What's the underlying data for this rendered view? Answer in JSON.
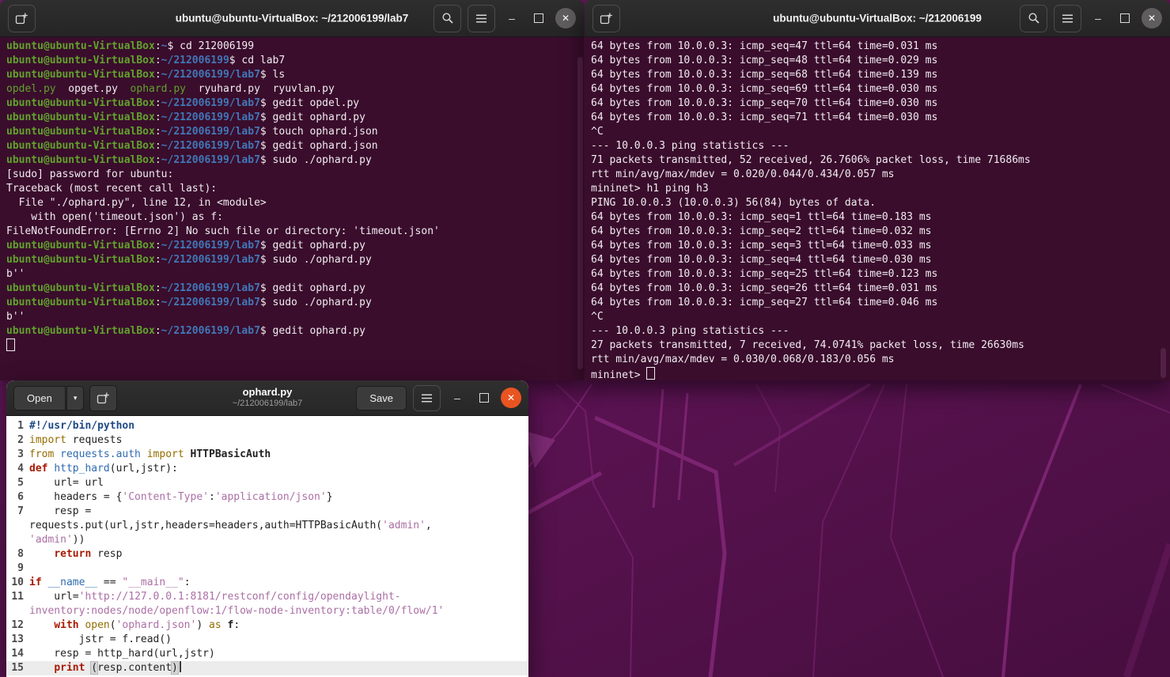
{
  "colors": {
    "accent_orange": "#e95420",
    "terminal_bg": "#3a0d2c",
    "titlebar_bg": "#2c2b2b",
    "prompt_green": "#61a32c",
    "path_blue": "#4177b8",
    "wallpaper_purple": "#5c1353",
    "wallpaper_line": "#822878",
    "string_purple": "#ab6fa5",
    "keyword_red": "#a81a03",
    "import_olive": "#946d00",
    "comment_blue": "#204a87",
    "function_blue": "#2f6bb0"
  },
  "window_glyphs": {
    "minimize": "–",
    "close": "✕",
    "dropdown": "▾"
  },
  "icon_names": [
    "new-tab-icon",
    "search-icon",
    "hamburger-menu-icon",
    "minimize-icon",
    "maximize-icon",
    "close-icon",
    "new-document-icon",
    "dropdown-caret-icon",
    "terminal-cursor"
  ],
  "terminal_left": {
    "title": "ubuntu@ubuntu-VirtualBox: ~/212006199/lab7",
    "lines": [
      [
        [
          "u",
          "ubuntu@ubuntu-VirtualBox"
        ],
        [
          "w",
          ":"
        ],
        [
          "p",
          "~"
        ],
        [
          "w",
          "$ cd 212006199"
        ]
      ],
      [
        [
          "u",
          "ubuntu@ubuntu-VirtualBox"
        ],
        [
          "w",
          ":"
        ],
        [
          "p",
          "~/212006199"
        ],
        [
          "w",
          "$ cd lab7"
        ]
      ],
      [
        [
          "u",
          "ubuntu@ubuntu-VirtualBox"
        ],
        [
          "w",
          ":"
        ],
        [
          "p",
          "~/212006199/lab7"
        ],
        [
          "w",
          "$ ls"
        ]
      ],
      [
        [
          "g",
          "opdel.py"
        ],
        [
          "w",
          "  opget.py  "
        ],
        [
          "g",
          "ophard.py"
        ],
        [
          "w",
          "  ryuhard.py  ryuvlan.py"
        ]
      ],
      [
        [
          "u",
          "ubuntu@ubuntu-VirtualBox"
        ],
        [
          "w",
          ":"
        ],
        [
          "p",
          "~/212006199/lab7"
        ],
        [
          "w",
          "$ gedit opdel.py"
        ]
      ],
      [
        [
          "u",
          "ubuntu@ubuntu-VirtualBox"
        ],
        [
          "w",
          ":"
        ],
        [
          "p",
          "~/212006199/lab7"
        ],
        [
          "w",
          "$ gedit ophard.py"
        ]
      ],
      [
        [
          "u",
          "ubuntu@ubuntu-VirtualBox"
        ],
        [
          "w",
          ":"
        ],
        [
          "p",
          "~/212006199/lab7"
        ],
        [
          "w",
          "$ touch ophard.json"
        ]
      ],
      [
        [
          "u",
          "ubuntu@ubuntu-VirtualBox"
        ],
        [
          "w",
          ":"
        ],
        [
          "p",
          "~/212006199/lab7"
        ],
        [
          "w",
          "$ gedit ophard.json"
        ]
      ],
      [
        [
          "u",
          "ubuntu@ubuntu-VirtualBox"
        ],
        [
          "w",
          ":"
        ],
        [
          "p",
          "~/212006199/lab7"
        ],
        [
          "w",
          "$ sudo ./ophard.py"
        ]
      ],
      [
        [
          "w",
          "[sudo] password for ubuntu:"
        ]
      ],
      [
        [
          "w",
          "Traceback (most recent call last):"
        ]
      ],
      [
        [
          "w",
          "  File \"./ophard.py\", line 12, in <module>"
        ]
      ],
      [
        [
          "w",
          "    with open('timeout.json') as f:"
        ]
      ],
      [
        [
          "w",
          "FileNotFoundError: [Errno 2] No such file or directory: 'timeout.json'"
        ]
      ],
      [
        [
          "u",
          "ubuntu@ubuntu-VirtualBox"
        ],
        [
          "w",
          ":"
        ],
        [
          "p",
          "~/212006199/lab7"
        ],
        [
          "w",
          "$ gedit ophard.py"
        ]
      ],
      [
        [
          "u",
          "ubuntu@ubuntu-VirtualBox"
        ],
        [
          "w",
          ":"
        ],
        [
          "p",
          "~/212006199/lab7"
        ],
        [
          "w",
          "$ sudo ./ophard.py"
        ]
      ],
      [
        [
          "w",
          "b''"
        ]
      ],
      [
        [
          "u",
          "ubuntu@ubuntu-VirtualBox"
        ],
        [
          "w",
          ":"
        ],
        [
          "p",
          "~/212006199/lab7"
        ],
        [
          "w",
          "$ gedit ophard.py"
        ]
      ],
      [
        [
          "u",
          "ubuntu@ubuntu-VirtualBox"
        ],
        [
          "w",
          ":"
        ],
        [
          "p",
          "~/212006199/lab7"
        ],
        [
          "w",
          "$ sudo ./ophard.py"
        ]
      ],
      [
        [
          "w",
          "b''"
        ]
      ],
      [
        [
          "u",
          "ubuntu@ubuntu-VirtualBox"
        ],
        [
          "w",
          ":"
        ],
        [
          "p",
          "~/212006199/lab7"
        ],
        [
          "w",
          "$ gedit ophard.py"
        ]
      ],
      [
        [
          "cursor",
          ""
        ]
      ]
    ]
  },
  "terminal_right": {
    "title": "ubuntu@ubuntu-VirtualBox: ~/212006199",
    "lines": [
      [
        [
          "w",
          "64 bytes from 10.0.0.3: icmp_seq=47 ttl=64 time=0.031 ms"
        ]
      ],
      [
        [
          "w",
          "64 bytes from 10.0.0.3: icmp_seq=48 ttl=64 time=0.029 ms"
        ]
      ],
      [
        [
          "w",
          "64 bytes from 10.0.0.3: icmp_seq=68 ttl=64 time=0.139 ms"
        ]
      ],
      [
        [
          "w",
          "64 bytes from 10.0.0.3: icmp_seq=69 ttl=64 time=0.030 ms"
        ]
      ],
      [
        [
          "w",
          "64 bytes from 10.0.0.3: icmp_seq=70 ttl=64 time=0.030 ms"
        ]
      ],
      [
        [
          "w",
          "64 bytes from 10.0.0.3: icmp_seq=71 ttl=64 time=0.030 ms"
        ]
      ],
      [
        [
          "w",
          "^C"
        ]
      ],
      [
        [
          "w",
          "--- 10.0.0.3 ping statistics ---"
        ]
      ],
      [
        [
          "w",
          "71 packets transmitted, 52 received, 26.7606% packet loss, time 71686ms"
        ]
      ],
      [
        [
          "w",
          "rtt min/avg/max/mdev = 0.020/0.044/0.434/0.057 ms"
        ]
      ],
      [
        [
          "w",
          "mininet> h1 ping h3"
        ]
      ],
      [
        [
          "w",
          "PING 10.0.0.3 (10.0.0.3) 56(84) bytes of data."
        ]
      ],
      [
        [
          "w",
          "64 bytes from 10.0.0.3: icmp_seq=1 ttl=64 time=0.183 ms"
        ]
      ],
      [
        [
          "w",
          "64 bytes from 10.0.0.3: icmp_seq=2 ttl=64 time=0.032 ms"
        ]
      ],
      [
        [
          "w",
          "64 bytes from 10.0.0.3: icmp_seq=3 ttl=64 time=0.033 ms"
        ]
      ],
      [
        [
          "w",
          "64 bytes from 10.0.0.3: icmp_seq=4 ttl=64 time=0.030 ms"
        ]
      ],
      [
        [
          "w",
          "64 bytes from 10.0.0.3: icmp_seq=25 ttl=64 time=0.123 ms"
        ]
      ],
      [
        [
          "w",
          "64 bytes from 10.0.0.3: icmp_seq=26 ttl=64 time=0.031 ms"
        ]
      ],
      [
        [
          "w",
          "64 bytes from 10.0.0.3: icmp_seq=27 ttl=64 time=0.046 ms"
        ]
      ],
      [
        [
          "w",
          "^C"
        ]
      ],
      [
        [
          "w",
          "--- 10.0.0.3 ping statistics ---"
        ]
      ],
      [
        [
          "w",
          "27 packets transmitted, 7 received, 74.0741% packet loss, time 26630ms"
        ]
      ],
      [
        [
          "w",
          "rtt min/avg/max/mdev = 0.030/0.068/0.183/0.056 ms"
        ]
      ],
      [
        [
          "w",
          "mininet> "
        ],
        [
          "cursor",
          ""
        ]
      ]
    ]
  },
  "gedit": {
    "open_label": "Open",
    "save_label": "Save",
    "title": "ophard.py",
    "subtitle": "~/212006199/lab7",
    "rows": [
      {
        "n": "1",
        "seg": [
          [
            "kc",
            "#!/usr/bin/python"
          ]
        ]
      },
      {
        "n": "2",
        "seg": [
          [
            "km",
            "import"
          ],
          [
            "d",
            " requests"
          ]
        ]
      },
      {
        "n": "3",
        "seg": [
          [
            "km",
            "from"
          ],
          [
            "d",
            " "
          ],
          [
            "kf",
            "requests.auth"
          ],
          [
            "d",
            " "
          ],
          [
            "km",
            "import"
          ],
          [
            "d",
            " "
          ],
          [
            "kb",
            "HTTPBasicAuth"
          ]
        ]
      },
      {
        "n": "4",
        "seg": [
          [
            "kk",
            "def"
          ],
          [
            "d",
            " "
          ],
          [
            "kf",
            "http_hard"
          ],
          [
            "d",
            "(url,jstr):"
          ]
        ]
      },
      {
        "n": "5",
        "seg": [
          [
            "d",
            "    url= url"
          ]
        ]
      },
      {
        "n": "6",
        "seg": [
          [
            "d",
            "    headers = {"
          ],
          [
            "ks",
            "'Content-Type'"
          ],
          [
            "d",
            ":"
          ],
          [
            "ks",
            "'application/json'"
          ],
          [
            "d",
            "}"
          ]
        ]
      },
      {
        "n": "7",
        "seg": [
          [
            "d",
            "    resp ="
          ]
        ]
      },
      {
        "n": "",
        "seg": [
          [
            "d",
            "requests.put(url,jstr,headers=headers,auth=HTTPBasicAuth("
          ],
          [
            "ks",
            "'admin'"
          ],
          [
            "d",
            ","
          ]
        ]
      },
      {
        "n": "",
        "seg": [
          [
            "ks",
            "'admin'"
          ],
          [
            "d",
            "))"
          ]
        ]
      },
      {
        "n": "8",
        "seg": [
          [
            "d",
            "    "
          ],
          [
            "kk",
            "return"
          ],
          [
            "d",
            " resp"
          ]
        ]
      },
      {
        "n": "9",
        "seg": []
      },
      {
        "n": "10",
        "seg": [
          [
            "kk",
            "if"
          ],
          [
            "d",
            " "
          ],
          [
            "kf",
            "__name__"
          ],
          [
            "d",
            " == "
          ],
          [
            "ks",
            "\"__main__\""
          ],
          [
            "d",
            ":"
          ]
        ]
      },
      {
        "n": "11",
        "seg": [
          [
            "d",
            "    url="
          ],
          [
            "ks",
            "'http://127.0.0.1:8181/restconf/config/opendaylight-"
          ]
        ]
      },
      {
        "n": "",
        "seg": [
          [
            "ks",
            "inventory:nodes/node/openflow:1/flow-node-inventory:table/0/flow/1'"
          ]
        ]
      },
      {
        "n": "12",
        "seg": [
          [
            "d",
            "    "
          ],
          [
            "kk",
            "with"
          ],
          [
            "d",
            " "
          ],
          [
            "km",
            "open"
          ],
          [
            "d",
            "("
          ],
          [
            "ks",
            "'ophard.json'"
          ],
          [
            "d",
            ") "
          ],
          [
            "km",
            "as"
          ],
          [
            "d",
            " "
          ],
          [
            "kb",
            "f"
          ],
          [
            "d",
            ":"
          ]
        ]
      },
      {
        "n": "13",
        "seg": [
          [
            "d",
            "        jstr = f.read()"
          ]
        ]
      },
      {
        "n": "14",
        "seg": [
          [
            "d",
            "    resp = http_hard(url,jstr)"
          ]
        ]
      },
      {
        "n": "15",
        "cur": true,
        "seg": [
          [
            "d",
            "    "
          ],
          [
            "kk",
            "print"
          ],
          [
            "d",
            " "
          ],
          [
            "bx",
            "("
          ],
          [
            "d",
            "resp.content"
          ],
          [
            "bx",
            ")"
          ],
          [
            "caret",
            ""
          ]
        ]
      }
    ]
  }
}
